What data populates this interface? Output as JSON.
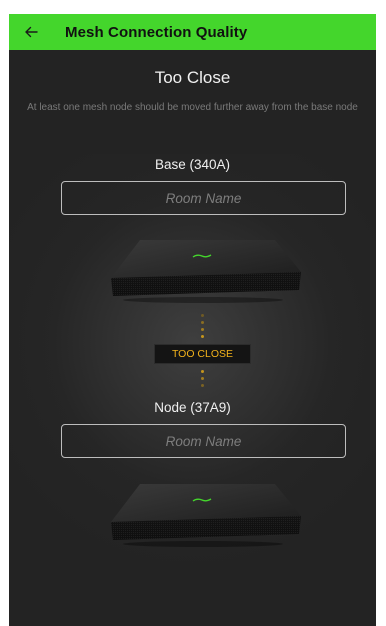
{
  "app_bar": {
    "title": "Mesh Connection Quality",
    "back_icon": "back-arrow-icon",
    "color": "#44d62c"
  },
  "status": {
    "heading": "Too Close",
    "description": "At least one mesh node should be moved further away from the base node",
    "badge": "TOO CLOSE",
    "badge_color": "#f2b21b"
  },
  "base": {
    "label": "Base (340A)",
    "room_placeholder": "Room Name",
    "room_value": ""
  },
  "node": {
    "label": "Node (37A9)",
    "room_placeholder": "Room Name",
    "room_value": ""
  }
}
